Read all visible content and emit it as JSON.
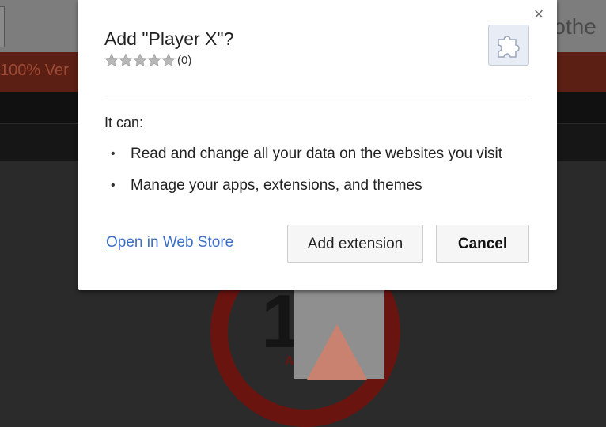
{
  "background": {
    "partial_heading": "e othe",
    "banner_text": "100% Ver",
    "logo_text": "18+",
    "logo_small_text": "ADU"
  },
  "dialog": {
    "title": "Add \"Player X\"?",
    "rating": {
      "stars_filled": 0,
      "stars_total": 5,
      "count_text": "(0)"
    },
    "icon": "puzzle-piece-icon",
    "close_label": "×",
    "permissions_heading": "It can:",
    "permissions": [
      "Read and change all your data on the websites you visit",
      "Manage your apps, extensions, and themes"
    ],
    "bullet": "•",
    "store_link_label": "Open in Web Store",
    "add_button_label": "Add extension",
    "cancel_button_label": "Cancel"
  },
  "colors": {
    "link": "#3d6fc6",
    "star_empty": "#b8b8b8",
    "icon_bg": "#e8ecf4"
  }
}
